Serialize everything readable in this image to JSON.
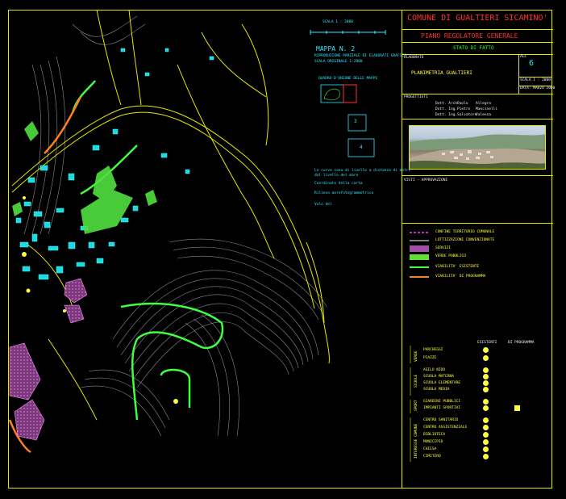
{
  "map": {
    "scale_label": "SCALA 1 : 2000",
    "sheet_title": "MAPPA N. 2",
    "sheet_subtitle": "RIPRODUZIONE PARZIALE DI ELABORATI GRAFICI",
    "sheet_subtitle2": "SCALA ORIGINALE 1:2000",
    "index_title": "QUADRO D'UNIONE DELLE MAPPE",
    "index_numbers": [
      "3",
      "4"
    ],
    "notes": [
      "Le curve sono di livello a distanza di metri",
      "dal livello del mare",
      "Coordinate della carta",
      "Rilievo aerofotogrammetrico",
      "Volo del"
    ]
  },
  "title_block": {
    "comune": "COMUNE DI GUALTIERI SICAMINO'",
    "piano": "PIANO REGOLATORE GENERALE",
    "stato": "STATO DI FATTO",
    "elaborato_label": "ELABORATO",
    "elaborato_title": "PLANIMETRIA GUALTIERI",
    "all_label": "ALL",
    "all_number": "6",
    "scala": "SCALA 1 : 2000",
    "data": "DATA: MARZO 2000",
    "progettisti_label": "PROGETTISTI",
    "progettisti": [
      [
        "Dott. Arch.",
        "Paolo",
        "Allegra"
      ],
      [
        "Dott. Ing.",
        "Pietro",
        "Mancinelli"
      ],
      [
        "Dott. Ing.",
        "Salvatore",
        "Valenza"
      ]
    ],
    "visti_label": "VISTI - APPROVAZIONI"
  },
  "legend": {
    "lines": [
      {
        "label": "CONFINE TERRITORIO COMUNALE",
        "color": "#ff40ff"
      },
      {
        "label": "LOTTIZZAZIONI CONVENZIONATE",
        "color": "#ffffff"
      },
      {
        "label": "SERVIZI",
        "color": "#c060c0"
      },
      {
        "label": "VERDE PUBBLICO",
        "color": "#80ff40"
      },
      {
        "label": "VIABILITA' ESISTENTE",
        "color": "#40ff40"
      },
      {
        "label": "VIABILITA' DI PROGRAMMA",
        "color": "#ff8020"
      }
    ],
    "col_existing": "ESISTENTI",
    "col_program": "DI PROGRAMMA",
    "groups": [
      {
        "name": "VERDE",
        "items": [
          "PARCHEGGI",
          "PIAZZE"
        ]
      },
      {
        "name": "SCUOLE",
        "items": [
          "ASILO NIDO",
          "SCUOLA MATERNA",
          "SCUOLA ELEMENTARE",
          "SCUOLA MEDIA"
        ]
      },
      {
        "name": "SPORT",
        "items": [
          "GIARDINI PUBBLICI",
          "IMPIANTI SPORTIVI"
        ]
      },
      {
        "name": "INTERESSE COMUNE",
        "items": [
          "CENTRO SANITARIO",
          "CENTRO ASSISTENZIALE",
          "BIBLIOTECA",
          "MUNICIPIO",
          "CHIESA",
          "CIMITERO"
        ]
      }
    ]
  }
}
